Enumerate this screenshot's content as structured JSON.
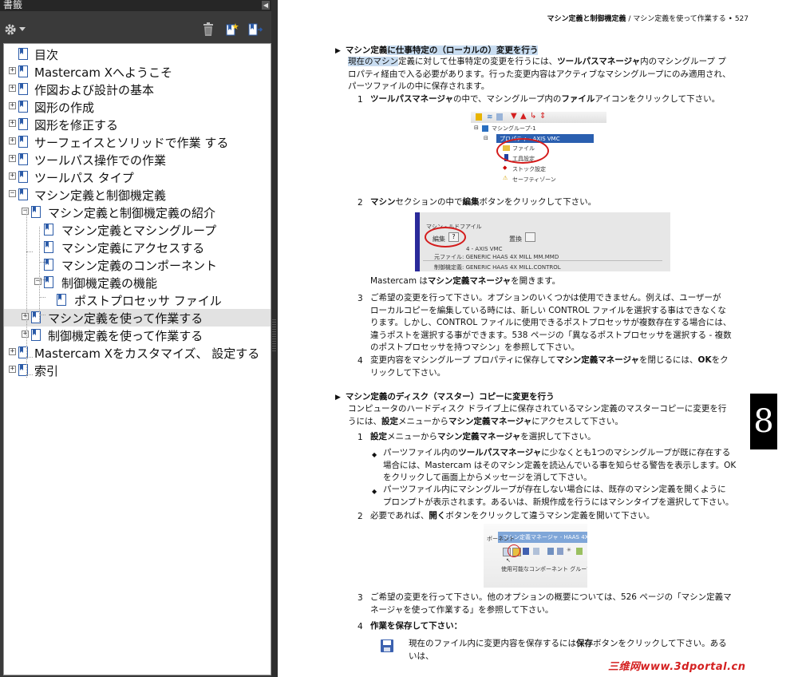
{
  "panel": {
    "title": "書籤",
    "collapse_icon": "triangle-left-icon",
    "toolbar_icons": [
      "gear-icon",
      "chevron-down-icon",
      "trash-icon",
      "new-bookmark-icon",
      "expand-bookmark-icon"
    ]
  },
  "bookmarks": [
    {
      "label": "目次",
      "level": 0,
      "expander": ""
    },
    {
      "label": "Mastercam Xへようこそ",
      "level": 0,
      "expander": "+"
    },
    {
      "label": "作図および設計の基本",
      "level": 0,
      "expander": "+"
    },
    {
      "label": "図形の作成",
      "level": 0,
      "expander": "+"
    },
    {
      "label": "図形を修正する",
      "level": 0,
      "expander": "+"
    },
    {
      "label": "サーフェイスとソリッドで作業 する",
      "level": 0,
      "expander": "+"
    },
    {
      "label": "ツールパス操作での作業",
      "level": 0,
      "expander": "+"
    },
    {
      "label": "ツールパス タイプ",
      "level": 0,
      "expander": "+"
    },
    {
      "label": "マシン定義と制御機定義",
      "level": 0,
      "expander": "−"
    },
    {
      "label": "マシン定義と制御機定義の紹介",
      "level": 1,
      "expander": "−"
    },
    {
      "label": "マシン定義とマシングループ",
      "level": 2,
      "expander": ""
    },
    {
      "label": "マシン定義にアクセスする",
      "level": 2,
      "expander": ""
    },
    {
      "label": "マシン定義のコンポーネント",
      "level": 2,
      "expander": ""
    },
    {
      "label": "制御機定義の機能",
      "level": 2,
      "expander": "−"
    },
    {
      "label": "ポストプロセッサ ファイル",
      "level": 3,
      "expander": ""
    },
    {
      "label": "マシン定義を使って作業する",
      "level": 1,
      "expander": "+",
      "selected": true
    },
    {
      "label": "制御機定義を使って作業する",
      "level": 1,
      "expander": "+"
    },
    {
      "label": "Mastercam Xをカスタマイズ、 設定する",
      "level": 0,
      "expander": "+"
    },
    {
      "label": "索引",
      "level": 0,
      "expander": "+"
    }
  ],
  "doc": {
    "running_header_bold": "マシン定義と制御機定義",
    "running_header_rest": " / マシン定義を使って作業する • 527",
    "chapter_number": "8",
    "section1": {
      "title_pre": "マシン定義",
      "title_hl": "に仕事特定の（ローカルの）変更を行う",
      "intro_hl": "現在のマシン",
      "intro_1": "定義に対して仕事特定の変更を行うには、",
      "intro_b": "ツールパスマネージャ",
      "intro_2": "内のマシングループ プ",
      "intro_line2": "ロパティ経由で入る必要があります。行った変更内容はアクティブなマシングループにのみ適用され、",
      "intro_line3": "パーツファイルの中に保存されます。",
      "steps": [
        {
          "num": "1",
          "b1": "ツールパスマネージャ",
          "t1": "の中で、マシングループ内の",
          "b2": "ファイル",
          "t2": "アイコンをクリックして下さい。"
        },
        {
          "num": "2",
          "b1": "マシン",
          "t1": "セクションの中で",
          "b2": "編集",
          "t2": "ボタンをクリックして下さい。"
        },
        {
          "num": "3",
          "lines": [
            "ご希望の変更を行って下さい。オプションのいくつかは使用できません。例えば、ユーザーが",
            "ローカルコピーを編集している時には、新しい CONTROL ファイルを選択する事はできなくな",
            "ります。しかし、CONTROL ファイルに使用できるポストプロセッサが複数存在する場合には、",
            "違うポストを選択する事ができます。538 ページの「異なるポストプロセッサを選択する - 複数",
            "のポストプロセッサを持つマシン」を参照して下さい。"
          ]
        },
        {
          "num": "4",
          "line1_t": "変更内容をマシングループ プロパティに保存して",
          "line1_b": "マシン定義マネージャ",
          "line1_t2": "を閉じるには、",
          "line1_b2": "OK",
          "line1_t3": "をク",
          "line2": "リックして下さい。"
        }
      ],
      "after_fig2_t": "Mastercam は",
      "after_fig2_b": "マシン定義マネージャ",
      "after_fig2_t2": "を開きます。"
    },
    "section2": {
      "title_pre": "マシン定義",
      "title_rest": "のディスク（マスター）コピーに変更を行う",
      "intro_line1": "コンピュータのハードディスク ドライブ上に保存されているマシン定義のマスターコピーに変更を行",
      "intro_line2_t": "うには、",
      "intro_line2_b": "設定",
      "intro_line2_t2": "メニューから",
      "intro_line2_b2": "マシン定義マネージャ",
      "intro_line2_t3": "にアクセスして下さい。",
      "step1_b": "設定",
      "step1_t": "メニューから",
      "step1_b2": "マシン定義マネージャ",
      "step1_t2": "を選択して下さい。",
      "bullet1_l1_t": "パーツファイル内の",
      "bullet1_l1_b": "ツールパスマネージャ",
      "bullet1_l1_t2": "に少なくとも1つのマシングループが既に存在する",
      "bullet1_l2": "場合には、Mastercam はそのマシン定義を読込んでいる事を知らせる警告を表示します。OK",
      "bullet1_l3": "をクリックして画面上からメッセージを消して下さい。",
      "bullet2_l1": "パーツファイル内にマシングループが存在しない場合には、既存のマシン定義を開くように",
      "bullet2_l2": "プロンプトが表示されます。あるいは、新規作成を行うにはマシンタイプを選択して下さい。",
      "step2_t": "必要であれば、",
      "step2_b": "開く",
      "step2_t2": "ボタンをクリックして違うマシン定義を開いて下さい。",
      "step3_l1": "ご希望の変更を行って下さい。他のオプションの概要については、526 ページの「マシン定義マ",
      "step3_l2": "ネージャを使って作業する」を参照して下さい。",
      "step4": "作業を保存して下さい：",
      "save_l1_t": "現在のファイル内に変更内容を保存するには",
      "save_l1_b": "保存",
      "save_l1_t2": "ボタンをクリックして下さい。ある",
      "save_l2": "いは、"
    },
    "fig1": {
      "group": "マシングループ-1",
      "machine": "プロパティ - AXIS VMC",
      "file": "ファイル",
      "tool": "工具設定",
      "stock": "ストック設定",
      "safety": "セーフティゾーン"
    },
    "fig2": {
      "title": "マシン - ルドフアイル",
      "edit": "編集",
      "replace": "置換",
      "line1": "4 - AXIS VMC",
      "line2": "元ファイル: GENERIC HAAS 4X MILL MM.MMD",
      "line3": "制御機定義: GENERIC HAAS 4X MILL.CONTROL"
    },
    "fig3": {
      "title": "マシン定義マネージャ - HAAS 4X MILL MM.MMD",
      "sub": "ボーネント",
      "list": "使用可能なコンポーネント グループ"
    },
    "watermark": "三维网www.3dportal.cn"
  },
  "colors": {
    "highlight": "#c8dcf0",
    "circle": "#d41c1c",
    "watermark": "#d42020"
  }
}
